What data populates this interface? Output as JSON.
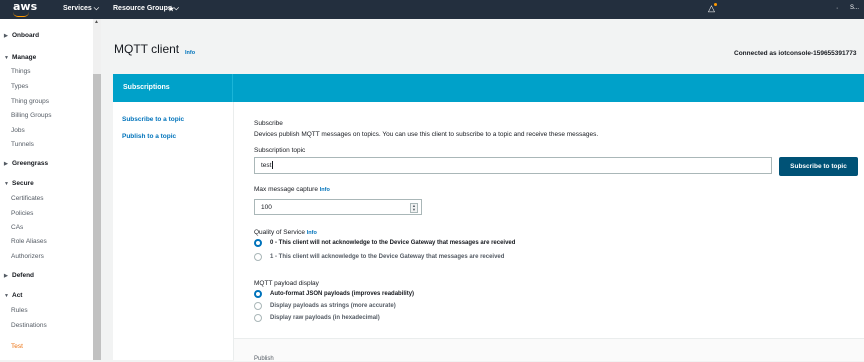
{
  "topbar": {
    "logo": "aws",
    "services": "Services ⌵",
    "resource_groups": "Resource Groups ⌵",
    "pin": "★",
    "bell": "△",
    "user_dot": "·",
    "user": "S..."
  },
  "sidebar": {
    "onboard": "Onboard",
    "manage": "Manage",
    "manage_items": [
      "Things",
      "Types",
      "Thing groups",
      "Billing Groups",
      "Jobs",
      "Tunnels"
    ],
    "greengrass": "Greengrass",
    "secure": "Secure",
    "secure_items": [
      "Certificates",
      "Policies",
      "CAs",
      "Role Aliases",
      "Authorizers"
    ],
    "defend": "Defend",
    "act": "Act",
    "act_items": [
      "Rules",
      "Destinations"
    ],
    "test": "Test"
  },
  "page": {
    "title": "MQTT client",
    "info": "Info",
    "connected": "Connected as iotconsole-159655391773"
  },
  "panel": {
    "header": "Subscriptions",
    "nav": [
      "Subscribe to a topic",
      "Publish to a topic"
    ]
  },
  "subscribe": {
    "heading": "Subscribe",
    "description": "Devices publish MQTT messages on topics. You can use this client to subscribe to a topic and receive these messages.",
    "topic_label": "Subscription topic",
    "topic_value": "test",
    "button": "Subscribe to topic",
    "max_label": "Max message capture",
    "max_info": "Info",
    "max_value": "100",
    "qos_label": "Quality of Service",
    "qos_info": "Info",
    "qos_options": [
      "0 - This client will not acknowledge to the Device Gateway that messages are received",
      "1 - This client will acknowledge to the Device Gateway that messages are received"
    ],
    "qos_selected": 0,
    "payload_label": "MQTT payload display",
    "payload_options": [
      "Auto-format JSON payloads (improves readability)",
      "Display payloads as strings (more accurate)",
      "Display raw payloads (in hexadecimal)"
    ],
    "payload_selected": 0
  },
  "footer": {
    "text": "Publish"
  },
  "colors": {
    "topbar": "#232f3e",
    "accent": "#ff9900",
    "panel_header": "#00a1c9",
    "button": "#005276",
    "link": "#0073bb",
    "active_nav": "#ec7211"
  }
}
